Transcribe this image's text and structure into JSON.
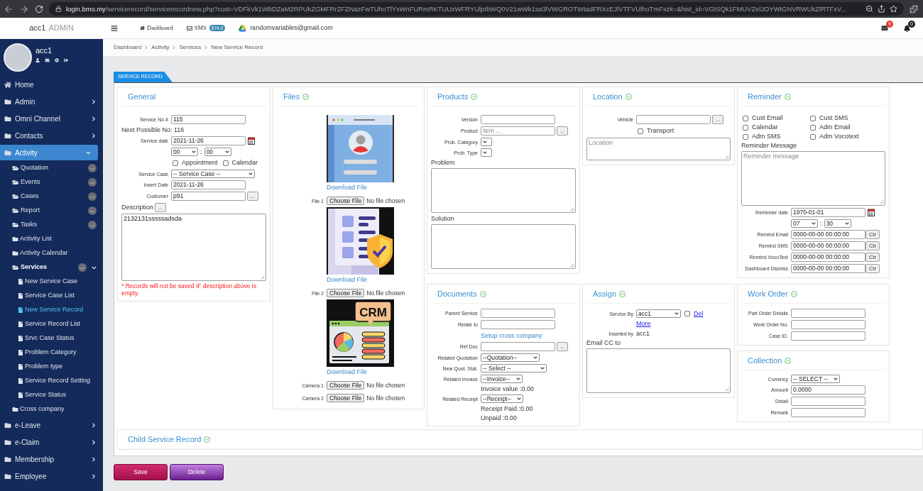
{
  "browser": {
    "host": "login.bmo.my",
    "path": "/servicerecord/servicerecordnew.php?cust=VDFkVk1WbDZaM2RPUkZGMFRrZFZNazFwTUhoTlYxWnFURmRKTUUxWFRYUlpIbWQ0V21wWk1sa3lVWGROTWtadFRXcEJlVTFVUlhoTmFszk=&hist_id=VGtSQk1FMUVZelJOYWtGNVRWUkZlRTFxV..."
  },
  "header": {
    "brand": "acc1",
    "role": "ADMIN",
    "links": [
      {
        "kind": "home",
        "label": "Dashboard"
      },
      {
        "kind": "sms",
        "label": "SMS",
        "badge": "874.0"
      },
      {
        "kind": "drive",
        "label": "randomvariables@gmail.com"
      }
    ],
    "alerts": [
      {
        "kind": "mail",
        "badge": "9"
      },
      {
        "kind": "bell",
        "badge": "0"
      }
    ]
  },
  "profile": {
    "name": "acc1"
  },
  "sidebar": {
    "items": [
      {
        "label": "Home",
        "kind": "home",
        "selected": false
      },
      {
        "label": "Admin",
        "kind": "section",
        "selected": false,
        "expanded": false
      },
      {
        "label": "Omni Channel",
        "kind": "section",
        "selected": false,
        "expanded": false
      },
      {
        "label": "Contacts",
        "kind": "section",
        "selected": false,
        "expanded": false
      },
      {
        "label": "Activity",
        "kind": "section",
        "selected": true,
        "expanded": true,
        "children": [
          {
            "label": "Quotation",
            "kind": "group",
            "selected": false,
            "expanded": false
          },
          {
            "label": "Events",
            "kind": "group",
            "selected": false,
            "expanded": false
          },
          {
            "label": "Cases",
            "kind": "group",
            "selected": false,
            "expanded": false
          },
          {
            "label": "Report",
            "kind": "group",
            "selected": false,
            "expanded": false
          },
          {
            "label": "Tasks",
            "kind": "group",
            "selected": false,
            "expanded": false
          },
          {
            "label": "Activity List",
            "kind": "link",
            "selected": false
          },
          {
            "label": "Activity Calendar",
            "kind": "link",
            "selected": false
          },
          {
            "label": "Services",
            "kind": "group",
            "selected": true,
            "expanded": true,
            "children": [
              {
                "label": "New Service Case",
                "selected": false
              },
              {
                "label": "Service Case List",
                "selected": false
              },
              {
                "label": "New Service Record",
                "selected": true
              },
              {
                "label": "Service Record List",
                "selected": false
              },
              {
                "label": "Srvc Case Status",
                "selected": false
              },
              {
                "label": "Problem Category",
                "selected": false
              },
              {
                "label": "Problem type",
                "selected": false
              },
              {
                "label": "Service Record Setting",
                "selected": false
              },
              {
                "label": "Service Status",
                "selected": false
              }
            ]
          },
          {
            "label": "Cross company",
            "kind": "link",
            "selected": false
          }
        ]
      },
      {
        "label": "e-Leave",
        "kind": "section",
        "selected": false,
        "expanded": false
      },
      {
        "label": "e-Claim",
        "kind": "section",
        "selected": false,
        "expanded": false
      },
      {
        "label": "Membership",
        "kind": "section",
        "selected": false,
        "expanded": false
      },
      {
        "label": "Employee",
        "kind": "section",
        "selected": false,
        "expanded": false
      }
    ]
  },
  "breadcrumb": [
    "Dashboard",
    "Activity",
    "Services",
    "New Service Record"
  ],
  "tab": {
    "label": "SERVICE RECORD",
    "selected": true
  },
  "form": {
    "general": {
      "title": "General",
      "fields": [
        {
          "kind": "text",
          "label": "Service No #",
          "value": "115"
        },
        {
          "kind": "line",
          "text": "Next Possible No: 116"
        },
        {
          "kind": "date",
          "label": "Service date",
          "value": "2021-11-26"
        },
        {
          "kind": "time",
          "hour": "00",
          "separator": ":",
          "minute": "00"
        },
        {
          "kind": "checks",
          "items": [
            {
              "label": "Appointment",
              "checked": false
            },
            {
              "label": "Calendar",
              "checked": false
            }
          ]
        },
        {
          "kind": "select",
          "label": "Service Case",
          "value": "-- Service Case --"
        },
        {
          "kind": "text",
          "label": "Insert Date",
          "value": "2021-11-26"
        },
        {
          "kind": "text",
          "label": "Customer",
          "value": "p91",
          "button": "..."
        },
        {
          "kind": "textarea",
          "label": "Description",
          "button": "...",
          "value": "2132131sssssadsda"
        },
        {
          "kind": "note",
          "text": "* Records will not be saved IF description above is empty."
        }
      ]
    },
    "files": {
      "title": "Files",
      "expanded": true,
      "fields": [
        {
          "kind": "preview",
          "link": "Download File"
        },
        {
          "kind": "upload",
          "label": "File 1",
          "button": "Choose File",
          "status": "No file chosen"
        },
        {
          "kind": "preview",
          "link": "Download File"
        },
        {
          "kind": "upload",
          "label": "File 2",
          "button": "Choose File",
          "status": "No file chosen"
        },
        {
          "kind": "preview",
          "link": "Download File",
          "art_text": "CRM"
        },
        {
          "kind": "upload",
          "label": "Camera 1",
          "button": "Choose File",
          "status": "No file chosen"
        },
        {
          "kind": "upload",
          "label": "Camera 2",
          "button": "Choose File",
          "status": "No file chosen"
        }
      ]
    },
    "products": {
      "title": "Products",
      "expanded": true,
      "fields": [
        {
          "kind": "text",
          "label": "Version"
        },
        {
          "kind": "text",
          "label": "Product",
          "placeholder": "item ...",
          "button": "..."
        },
        {
          "kind": "select",
          "label": "Prob. Category"
        },
        {
          "kind": "select",
          "label": "Prob. Type"
        },
        {
          "kind": "textarea",
          "label": "Problem"
        },
        {
          "kind": "textarea",
          "label": "Solution"
        }
      ]
    },
    "location": {
      "title": "Location",
      "expanded": true,
      "fields": [
        {
          "kind": "text",
          "label": "Vehicle",
          "button": "..."
        },
        {
          "kind": "checks",
          "items": [
            {
              "label": "Transport",
              "checked": false
            }
          ]
        },
        {
          "kind": "textarea",
          "placeholder": "Location"
        }
      ]
    },
    "reminder": {
      "title": "Reminder",
      "expanded": true,
      "fields": [
        {
          "kind": "checkgrid",
          "items": [
            {
              "label": "Cust Email",
              "checked": false
            },
            {
              "label": "Cust SMS",
              "checked": false
            },
            {
              "label": "Calendar",
              "checked": false
            },
            {
              "label": "Adm Email",
              "checked": false
            },
            {
              "label": "Adm SMS",
              "checked": false
            },
            {
              "label": "Adm Vocotext",
              "checked": false
            }
          ]
        },
        {
          "kind": "textarea",
          "label": "Reminder Message",
          "placeholder": "Reminder message"
        },
        {
          "kind": "date",
          "label": "Reminder date",
          "value": "1970-01-01"
        },
        {
          "kind": "time",
          "hour": "07",
          "separator": ":",
          "minute": "30"
        },
        {
          "kind": "clear",
          "label": "Remind Email",
          "value": "0000-00-00 00:00:00",
          "button": "Clr"
        },
        {
          "kind": "clear",
          "label": "Remind SMS",
          "value": "0000-00-00 00:00:00",
          "button": "Clr"
        },
        {
          "kind": "clear",
          "label": "Remind VocoText",
          "value": "0000-00-00 00:00:00",
          "button": "Clr"
        },
        {
          "kind": "clear",
          "label": "Dashboard Dismiss",
          "value": "0000-00-00 00:00:00",
          "button": "Clr"
        }
      ]
    },
    "documents": {
      "title": "Documents",
      "expanded": true,
      "fields": [
        {
          "kind": "text",
          "label": "Parent Service"
        },
        {
          "kind": "text",
          "label": "Relate to"
        },
        {
          "kind": "link",
          "text": "Setup cross company"
        },
        {
          "kind": "text",
          "label": "Ref Doc",
          "button": "..."
        },
        {
          "kind": "select",
          "label": "Related Quotation",
          "value": "--Quotation--"
        },
        {
          "kind": "select",
          "label": "New Quot. Stat.",
          "value": "-- Select --"
        },
        {
          "kind": "select",
          "label": "Related Invoice",
          "value": "--Invoice--"
        },
        {
          "kind": "info",
          "value": "Invoice value :0.00"
        },
        {
          "kind": "select",
          "label": "Related Receipt",
          "value": "--Receipt--"
        },
        {
          "kind": "info",
          "value": "Receipt Paid :0.00"
        },
        {
          "kind": "info",
          "value": "Unpaid :0.00"
        }
      ]
    },
    "assign": {
      "title": "Assign",
      "expanded": true,
      "fields": [
        {
          "kind": "select",
          "label": "Service By",
          "value": "acc1",
          "check": {
            "checked": false
          },
          "link": "Del"
        },
        {
          "kind": "anchor",
          "text": "More"
        },
        {
          "kind": "info",
          "label": "Inserted by",
          "value": "acc1"
        },
        {
          "kind": "textarea",
          "label": "Email CC to"
        }
      ]
    },
    "work_order": {
      "title": "Work Order",
      "expanded": true,
      "fields": [
        {
          "kind": "text",
          "label": "Part Order Details"
        },
        {
          "kind": "text",
          "label": "Work Order No."
        },
        {
          "kind": "text",
          "label": "Case ID."
        }
      ]
    },
    "collection": {
      "title": "Collection",
      "expanded": true,
      "fields": [
        {
          "kind": "select",
          "label": "Currency",
          "value": "-- SELECT --"
        },
        {
          "kind": "text",
          "label": "Amount",
          "value": "0.0000"
        },
        {
          "kind": "text",
          "label": "Detail"
        },
        {
          "kind": "text",
          "label": "Remark"
        }
      ]
    },
    "child_record": {
      "title": "Child Service Record",
      "expanded": false
    }
  },
  "buttons": [
    {
      "kind": "save",
      "label": "Save"
    },
    {
      "kind": "delete",
      "label": "Delete"
    }
  ]
}
